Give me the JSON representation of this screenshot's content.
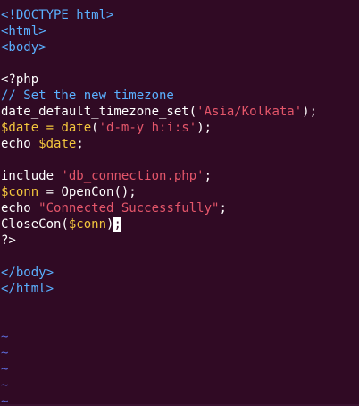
{
  "editor": {
    "colors": {
      "background": "#300a24",
      "tag": "#5ab0ff",
      "comment": "#5ab0ff",
      "string": "#e4566a",
      "variable": "#f3c63d",
      "text": "#ffffff",
      "tilde": "#5d6bd9"
    },
    "lines": [
      {
        "tokens": [
          {
            "text": "<!DOCTYPE html>",
            "kind": "tag"
          }
        ]
      },
      {
        "tokens": [
          {
            "text": "<html>",
            "kind": "tag"
          }
        ]
      },
      {
        "tokens": [
          {
            "text": "<body>",
            "kind": "tag"
          }
        ]
      },
      {
        "tokens": []
      },
      {
        "tokens": [
          {
            "text": "<?php",
            "kind": "text"
          }
        ]
      },
      {
        "tokens": [
          {
            "text": "// Set the new timezone",
            "kind": "comment"
          }
        ]
      },
      {
        "tokens": [
          {
            "text": "date_default_timezone_set(",
            "kind": "text"
          },
          {
            "text": "'Asia/Kolkata'",
            "kind": "string"
          },
          {
            "text": ");",
            "kind": "text"
          }
        ]
      },
      {
        "tokens": [
          {
            "text": "$date",
            "kind": "variable"
          },
          {
            "text": " = ",
            "kind": "variable"
          },
          {
            "text": "date",
            "kind": "variable"
          },
          {
            "text": "(",
            "kind": "text"
          },
          {
            "text": "'d-m-y h:i:s'",
            "kind": "string"
          },
          {
            "text": ");",
            "kind": "text"
          }
        ]
      },
      {
        "tokens": [
          {
            "text": "echo ",
            "kind": "text"
          },
          {
            "text": "$date",
            "kind": "variable"
          },
          {
            "text": ";",
            "kind": "text"
          }
        ]
      },
      {
        "tokens": []
      },
      {
        "tokens": [
          {
            "text": "include ",
            "kind": "text"
          },
          {
            "text": "'db_connection.php'",
            "kind": "string"
          },
          {
            "text": ";",
            "kind": "text"
          }
        ]
      },
      {
        "tokens": [
          {
            "text": "$conn",
            "kind": "variable"
          },
          {
            "text": " = ",
            "kind": "text"
          },
          {
            "text": "OpenCon();",
            "kind": "text"
          }
        ]
      },
      {
        "tokens": [
          {
            "text": "echo ",
            "kind": "text"
          },
          {
            "text": "\"Connected Successfully\"",
            "kind": "string"
          },
          {
            "text": ";",
            "kind": "text"
          }
        ]
      },
      {
        "tokens": [
          {
            "text": "CloseCon(",
            "kind": "text"
          },
          {
            "text": "$conn",
            "kind": "variable"
          },
          {
            "text": ")",
            "kind": "text"
          },
          {
            "text": ";",
            "kind": "cursor"
          }
        ]
      },
      {
        "tokens": [
          {
            "text": "?>",
            "kind": "text"
          }
        ]
      },
      {
        "tokens": []
      },
      {
        "tokens": [
          {
            "text": "</body>",
            "kind": "tag"
          }
        ]
      },
      {
        "tokens": [
          {
            "text": "</html>",
            "kind": "tag"
          }
        ]
      },
      {
        "tokens": []
      },
      {
        "tokens": []
      },
      {
        "tokens": [
          {
            "text": "~",
            "kind": "tilde"
          }
        ]
      },
      {
        "tokens": [
          {
            "text": "~",
            "kind": "tilde"
          }
        ]
      },
      {
        "tokens": [
          {
            "text": "~",
            "kind": "tilde"
          }
        ]
      },
      {
        "tokens": [
          {
            "text": "~",
            "kind": "tilde"
          }
        ]
      },
      {
        "tokens": [
          {
            "text": "~",
            "kind": "tilde"
          }
        ]
      },
      {
        "tokens": [
          {
            "text": "~",
            "kind": "tilde"
          }
        ]
      }
    ]
  }
}
